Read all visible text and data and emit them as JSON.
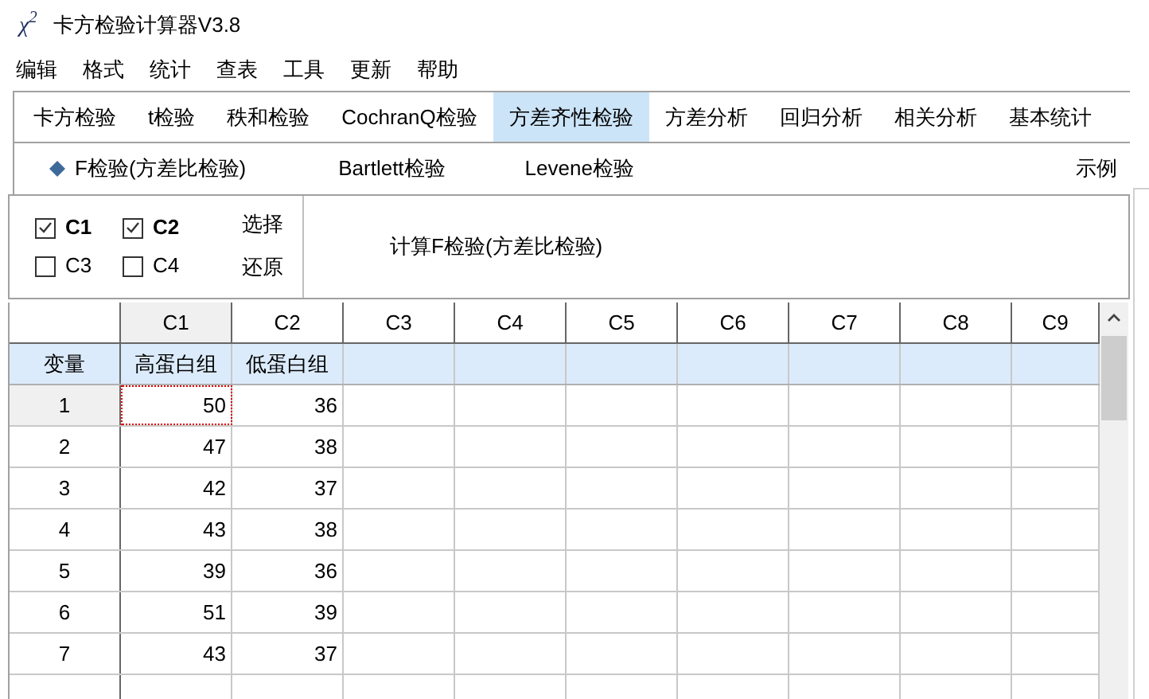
{
  "window": {
    "icon": "χ$^{2}$",
    "title": "卡方检验计算器V3.8"
  },
  "menu": [
    "编辑",
    "格式",
    "统计",
    "查表",
    "工具",
    "更新",
    "帮助"
  ],
  "tabs": [
    {
      "label": "卡方检验",
      "selected": false
    },
    {
      "label": "t检验",
      "selected": false
    },
    {
      "label": "秩和检验",
      "selected": false
    },
    {
      "label": "CochranQ检验",
      "selected": false
    },
    {
      "label": "方差齐性检验",
      "selected": true
    },
    {
      "label": "方差分析",
      "selected": false
    },
    {
      "label": "回归分析",
      "selected": false
    },
    {
      "label": "相关分析",
      "selected": false
    },
    {
      "label": "基本统计",
      "selected": false
    }
  ],
  "subtabs": [
    {
      "label": "F检验(方差比检验)",
      "selected": true
    },
    {
      "label": "Bartlett检验",
      "selected": false
    },
    {
      "label": "Levene检验",
      "selected": false
    }
  ],
  "example_link": "示例",
  "column_checkboxes": [
    {
      "label": "C1",
      "checked": true
    },
    {
      "label": "C2",
      "checked": true
    },
    {
      "label": "C3",
      "checked": false
    },
    {
      "label": "C4",
      "checked": false
    }
  ],
  "select_buttons": [
    "选择",
    "还原"
  ],
  "calculate_button": "计算F检验(方差比检验)",
  "grid": {
    "columns": [
      {
        "label": "C1",
        "selected": true
      },
      {
        "label": "C2",
        "selected": false
      },
      {
        "label": "C3",
        "selected": false
      },
      {
        "label": "C4",
        "selected": false
      },
      {
        "label": "C5",
        "selected": false
      },
      {
        "label": "C6",
        "selected": false
      },
      {
        "label": "C7",
        "selected": false
      },
      {
        "label": "C8",
        "selected": false
      },
      {
        "label": "C9",
        "selected": false
      }
    ],
    "rows": [
      {
        "kind": "names",
        "header": "变量",
        "cells": [
          "高蛋白组",
          "低蛋白组"
        ],
        "selected": false
      },
      {
        "kind": "data",
        "header": "1",
        "cells": [
          "50",
          "36"
        ],
        "selected": true
      },
      {
        "kind": "data",
        "header": "2",
        "cells": [
          "47",
          "38"
        ],
        "selected": false
      },
      {
        "kind": "data",
        "header": "3",
        "cells": [
          "42",
          "37"
        ],
        "selected": false
      },
      {
        "kind": "data",
        "header": "4",
        "cells": [
          "43",
          "38"
        ],
        "selected": false
      },
      {
        "kind": "data",
        "header": "5",
        "cells": [
          "39",
          "36"
        ],
        "selected": false
      },
      {
        "kind": "data",
        "header": "6",
        "cells": [
          "51",
          "39"
        ],
        "selected": false
      },
      {
        "kind": "data",
        "header": "7",
        "cells": [
          "43",
          "37"
        ],
        "selected": false
      }
    ]
  }
}
